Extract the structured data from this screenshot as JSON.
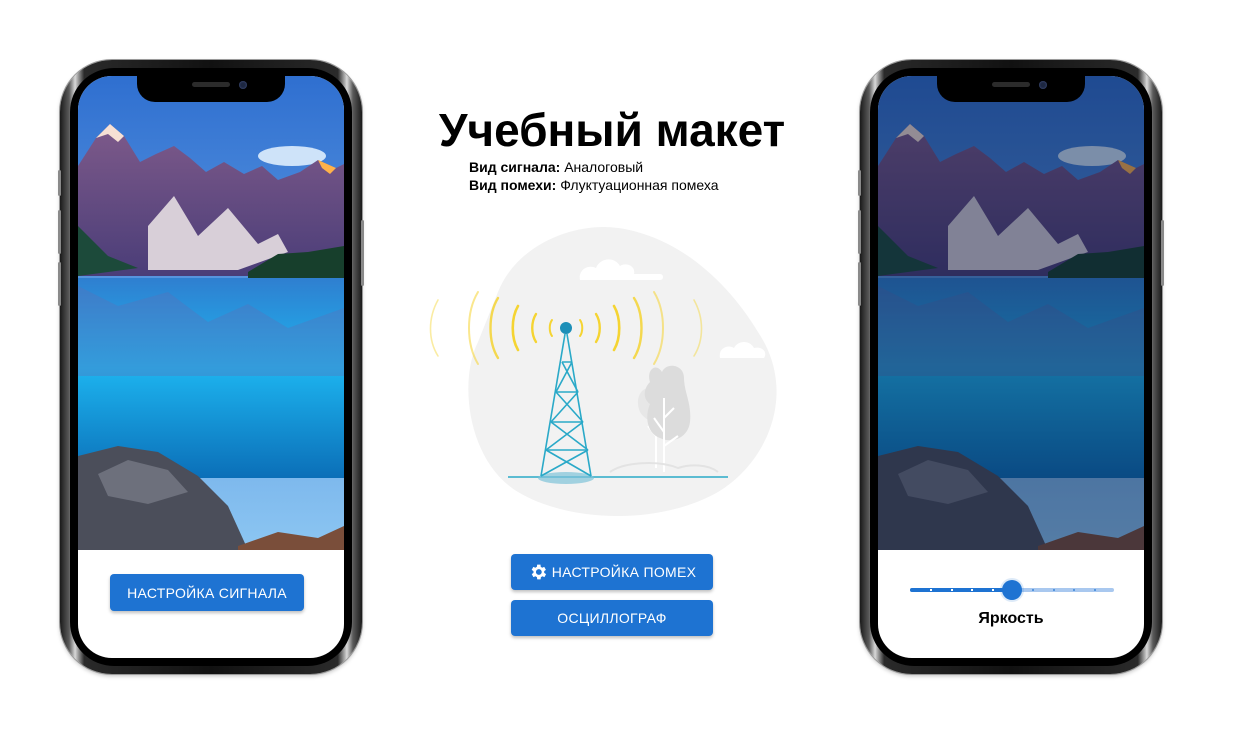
{
  "header": {
    "title": "Учебный макет",
    "signal_type_label": "Вид сигнала:",
    "signal_type_value": "Аналоговый",
    "noise_type_label": "Вид помехи:",
    "noise_type_value": "Флуктуационная помеха"
  },
  "left_phone": {
    "signal_button_label": "НАСТРОЙКА СИГНАЛА"
  },
  "center": {
    "noise_button_label": "НАСТРОЙКА ПОМЕХ",
    "noise_button_icon": "gear-icon",
    "oscillograph_button_label": "ОСЦИЛЛОГРАФ"
  },
  "right_phone": {
    "brightness_label": "Яркость",
    "brightness_value_fraction": 0.5,
    "brightness_steps": 10
  },
  "colors": {
    "accent": "#1e73d2",
    "tower": "#2aa9c8",
    "waves": "#f5d432"
  }
}
